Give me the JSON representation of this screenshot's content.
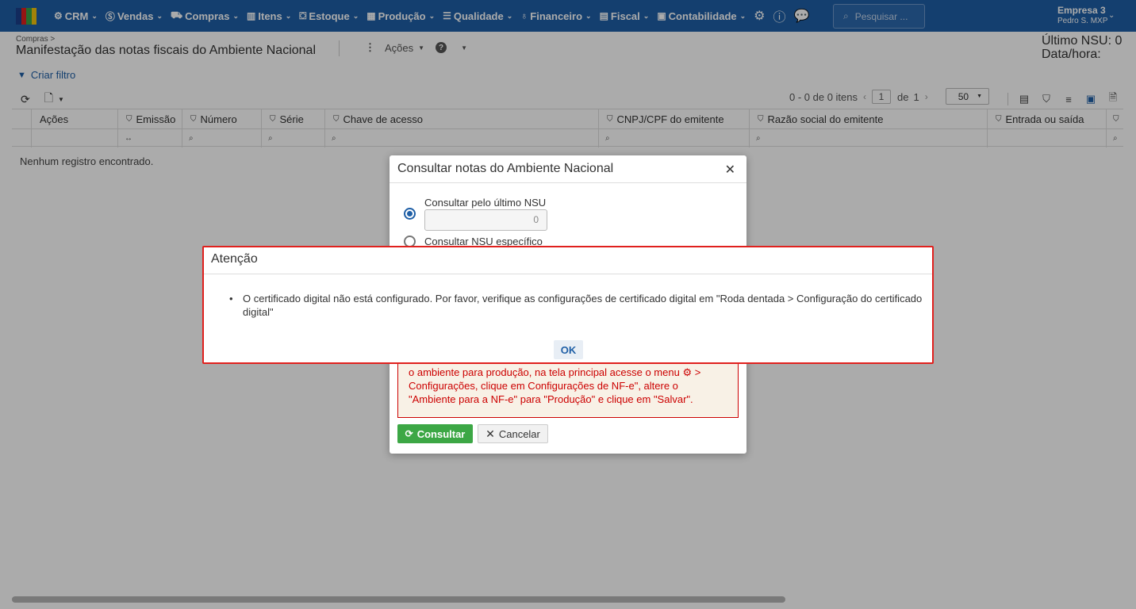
{
  "nav": {
    "items": [
      {
        "icon": "crm-icon",
        "glyph": "⚙",
        "label": "CRM"
      },
      {
        "icon": "dollar-icon",
        "glyph": "$",
        "label": "Vendas"
      },
      {
        "icon": "cart-icon",
        "glyph": "🛒",
        "label": "Compras"
      },
      {
        "icon": "barcode-icon",
        "glyph": "▥",
        "label": "Itens"
      },
      {
        "icon": "dolly-icon",
        "glyph": "⛟",
        "label": "Estoque"
      },
      {
        "icon": "chart-icon",
        "glyph": "▦",
        "label": "Produção"
      },
      {
        "icon": "checklist-icon",
        "glyph": "☰",
        "label": "Qualidade"
      },
      {
        "icon": "money-icon",
        "glyph": "💰",
        "label": "Financeiro"
      },
      {
        "icon": "document-icon",
        "glyph": "🗎",
        "label": "Fiscal"
      },
      {
        "icon": "calculator-icon",
        "glyph": "▣",
        "label": "Contabilidade"
      }
    ],
    "search_placeholder": "Pesquisar ...",
    "company": "Empresa 3",
    "user": "Pedro S. MXP",
    "brand_colors": [
      "#1b3f8b",
      "#e0201d",
      "#3aa346",
      "#f4c20d"
    ]
  },
  "header": {
    "breadcrumb": "Compras >",
    "title": "Manifestação das notas fiscais do Ambiente Nacional",
    "actions_label": "Ações",
    "nsu_label": "Último NSU: 0",
    "datetime_label": "Data/hora:"
  },
  "toolbar": {
    "filter_label": "Criar filtro",
    "pager_text": "0 - 0 de 0 itens",
    "page": "1",
    "of_label": "de",
    "total_pages": "1",
    "per_page": "50"
  },
  "grid": {
    "columns": [
      "Ações",
      "Emissão",
      "Número",
      "Série",
      "Chave de acesso",
      "CNPJ/CPF do emitente",
      "Razão social do emitente",
      "Entrada ou saída"
    ],
    "empty_message": "Nenhum registro encontrado."
  },
  "dialog": {
    "title": "Consultar notas do Ambiente Nacional",
    "option1": "Consultar pelo último NSU",
    "nsu_value": "0",
    "option2": "Consultar NSU específico",
    "warning_text": "o ambiente para produção, na tela principal acesse o menu ⚙ > Configurações, clique em Configurações de NF-e\", altere o \"Ambiente para a NF-e\" para \"Produção\" e clique em \"Salvar\".",
    "consult_label": "Consultar",
    "cancel_label": "Cancelar"
  },
  "alert": {
    "title": "Atenção",
    "message": "O certificado digital não está configurado. Por favor, verifique as configurações de certificado digital em \"Roda dentada > Configuração do certificado digital\"",
    "ok_label": "OK"
  }
}
